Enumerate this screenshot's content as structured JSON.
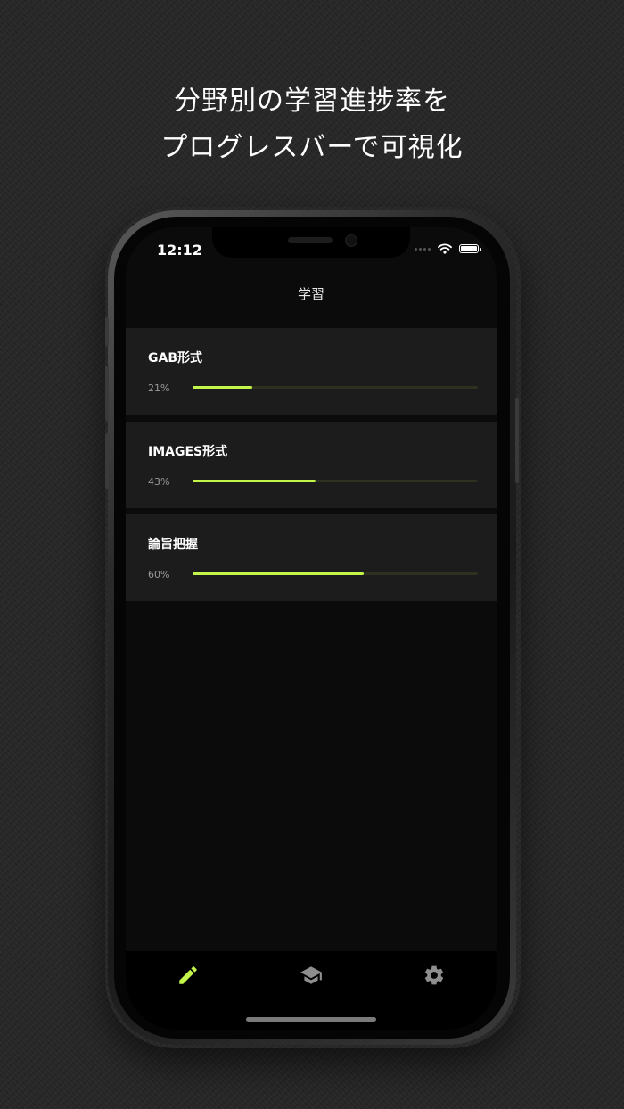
{
  "headline": {
    "line1": "分野別の学習進捗率を",
    "line2": "プログレスバーで可視化"
  },
  "status_bar": {
    "time": "12:12"
  },
  "nav": {
    "title": "学習"
  },
  "progress_items": [
    {
      "title": "GAB形式",
      "percent_label": "21%",
      "progress": 0.21
    },
    {
      "title": "IMAGES形式",
      "percent_label": "43%",
      "progress": 0.43
    },
    {
      "title": "論旨把握",
      "percent_label": "60%",
      "progress": 0.6
    }
  ],
  "tab_bar": {
    "tabs": [
      {
        "icon": "pencil-icon",
        "active": true
      },
      {
        "icon": "graduation-cap-icon",
        "active": false
      },
      {
        "icon": "gear-icon",
        "active": false
      }
    ]
  },
  "colors": {
    "accent": "#c4f54a",
    "track": "#2e3120",
    "card": "#1c1c1c",
    "screen": "#0b0b0b",
    "inactive_icon": "#8e8e8e"
  }
}
